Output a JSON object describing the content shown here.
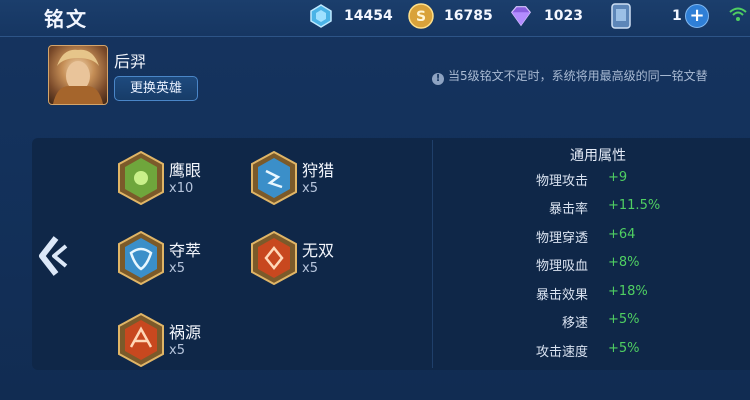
{
  "header": {
    "title": "铭文",
    "resources": [
      {
        "icon": "diamond-icon",
        "value": "14454"
      },
      {
        "icon": "gold-coin-icon",
        "value": "16785"
      },
      {
        "icon": "crystal-icon",
        "value": "1023"
      },
      {
        "icon": "ticket-card-icon",
        "value": "1"
      }
    ],
    "plus_label": "+"
  },
  "hero": {
    "name": "后羿",
    "swap_button": "更换英雄"
  },
  "notice": "当5级铭文不足时，系统将用最高级的同一铭文替",
  "runes": [
    {
      "name": "鹰眼",
      "count": "x10",
      "color": "#6fa63c"
    },
    {
      "name": "狩猎",
      "count": "x5",
      "color": "#3b8fc9"
    },
    {
      "name": "夺萃",
      "count": "x5",
      "color": "#3b8fc9"
    },
    {
      "name": "无双",
      "count": "x5",
      "color": "#c8481f"
    },
    {
      "name": "祸源",
      "count": "x5",
      "color": "#c8481f"
    }
  ],
  "attributes": {
    "header": "通用属性",
    "rows": [
      {
        "label": "物理攻击",
        "value": "+9"
      },
      {
        "label": "暴击率",
        "value": "+11.5%"
      },
      {
        "label": "物理穿透",
        "value": "+64"
      },
      {
        "label": "物理吸血",
        "value": "+8%"
      },
      {
        "label": "暴击效果",
        "value": "+18%"
      },
      {
        "label": "移速",
        "value": "+5%"
      },
      {
        "label": "攻击速度",
        "value": "+5%"
      }
    ]
  }
}
